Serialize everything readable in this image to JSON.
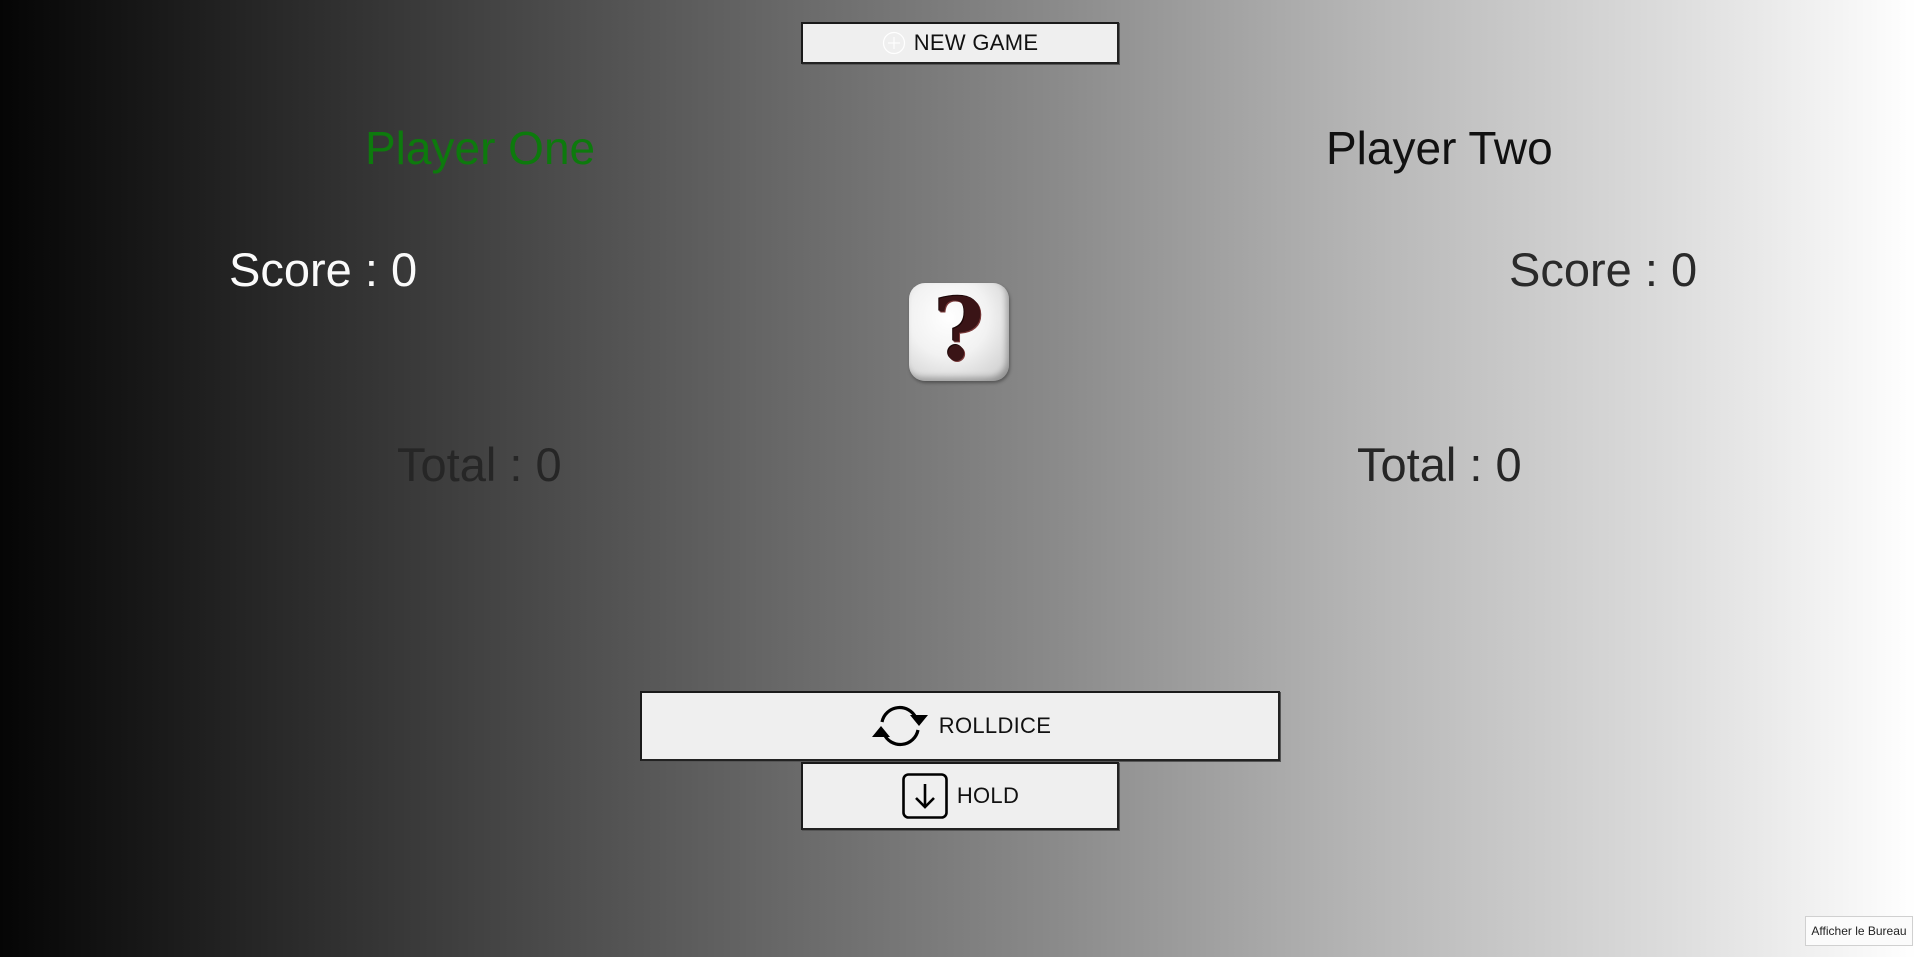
{
  "buttons": {
    "new_game": "NEW GAME",
    "roll_dice": "ROLLDICE",
    "hold": "HOLD"
  },
  "player_one": {
    "name": "Player One",
    "score": "Score : 0",
    "total": "Total : 0",
    "active": true,
    "name_color": "#0d7a0d"
  },
  "player_two": {
    "name": "Player Two",
    "score": "Score : 0",
    "total": "Total : 0",
    "active": false
  },
  "dice": {
    "face": "?",
    "icon": "question-mark-dice"
  },
  "icons": {
    "new_game": "plus-circle-icon",
    "roll_dice": "refresh-icon",
    "hold": "arrow-down-box-icon"
  },
  "tooltip": {
    "text": "Afficher le Bureau"
  }
}
